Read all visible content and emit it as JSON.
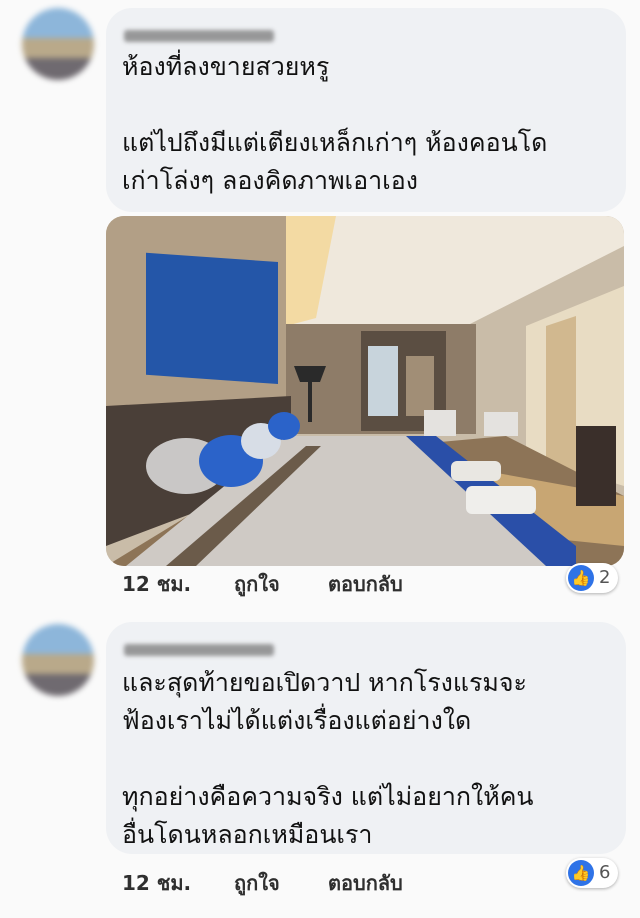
{
  "comments": [
    {
      "lines": "ห้องที่ลงขายสวยหรู\n\nแต่ไปถึงมีแต่เตียงเหล็กเก่าๆ ห้องคอนโด\nเก่าโล่งๆ ลองคิดภาพเอาเอง",
      "time": "12 ชม.",
      "like_label": "ถูกใจ",
      "reply_label": "ตอบกลับ",
      "reactions": "2",
      "reaction_icon": "thumbs-up-icon"
    },
    {
      "lines": "และสุดท้ายขอเปิดวาป หากโรงแรมจะ\nฟ้องเราไม่ได้แต่งเรื่องแต่อย่างใด\n\nทุกอย่างคือความจริง แต่ไม่อยากให้คน\nอื่นโดนหลอกเหมือนเรา",
      "time": "12 ชม.",
      "like_label": "ถูกใจ",
      "reply_label": "ตอบกลับ",
      "reactions": "6",
      "reaction_icon": "thumbs-up-icon"
    }
  ],
  "colors": {
    "bubble": "#eff1f4",
    "like_blue": "#2f73e7",
    "headboard_blue": "#2456a8"
  }
}
